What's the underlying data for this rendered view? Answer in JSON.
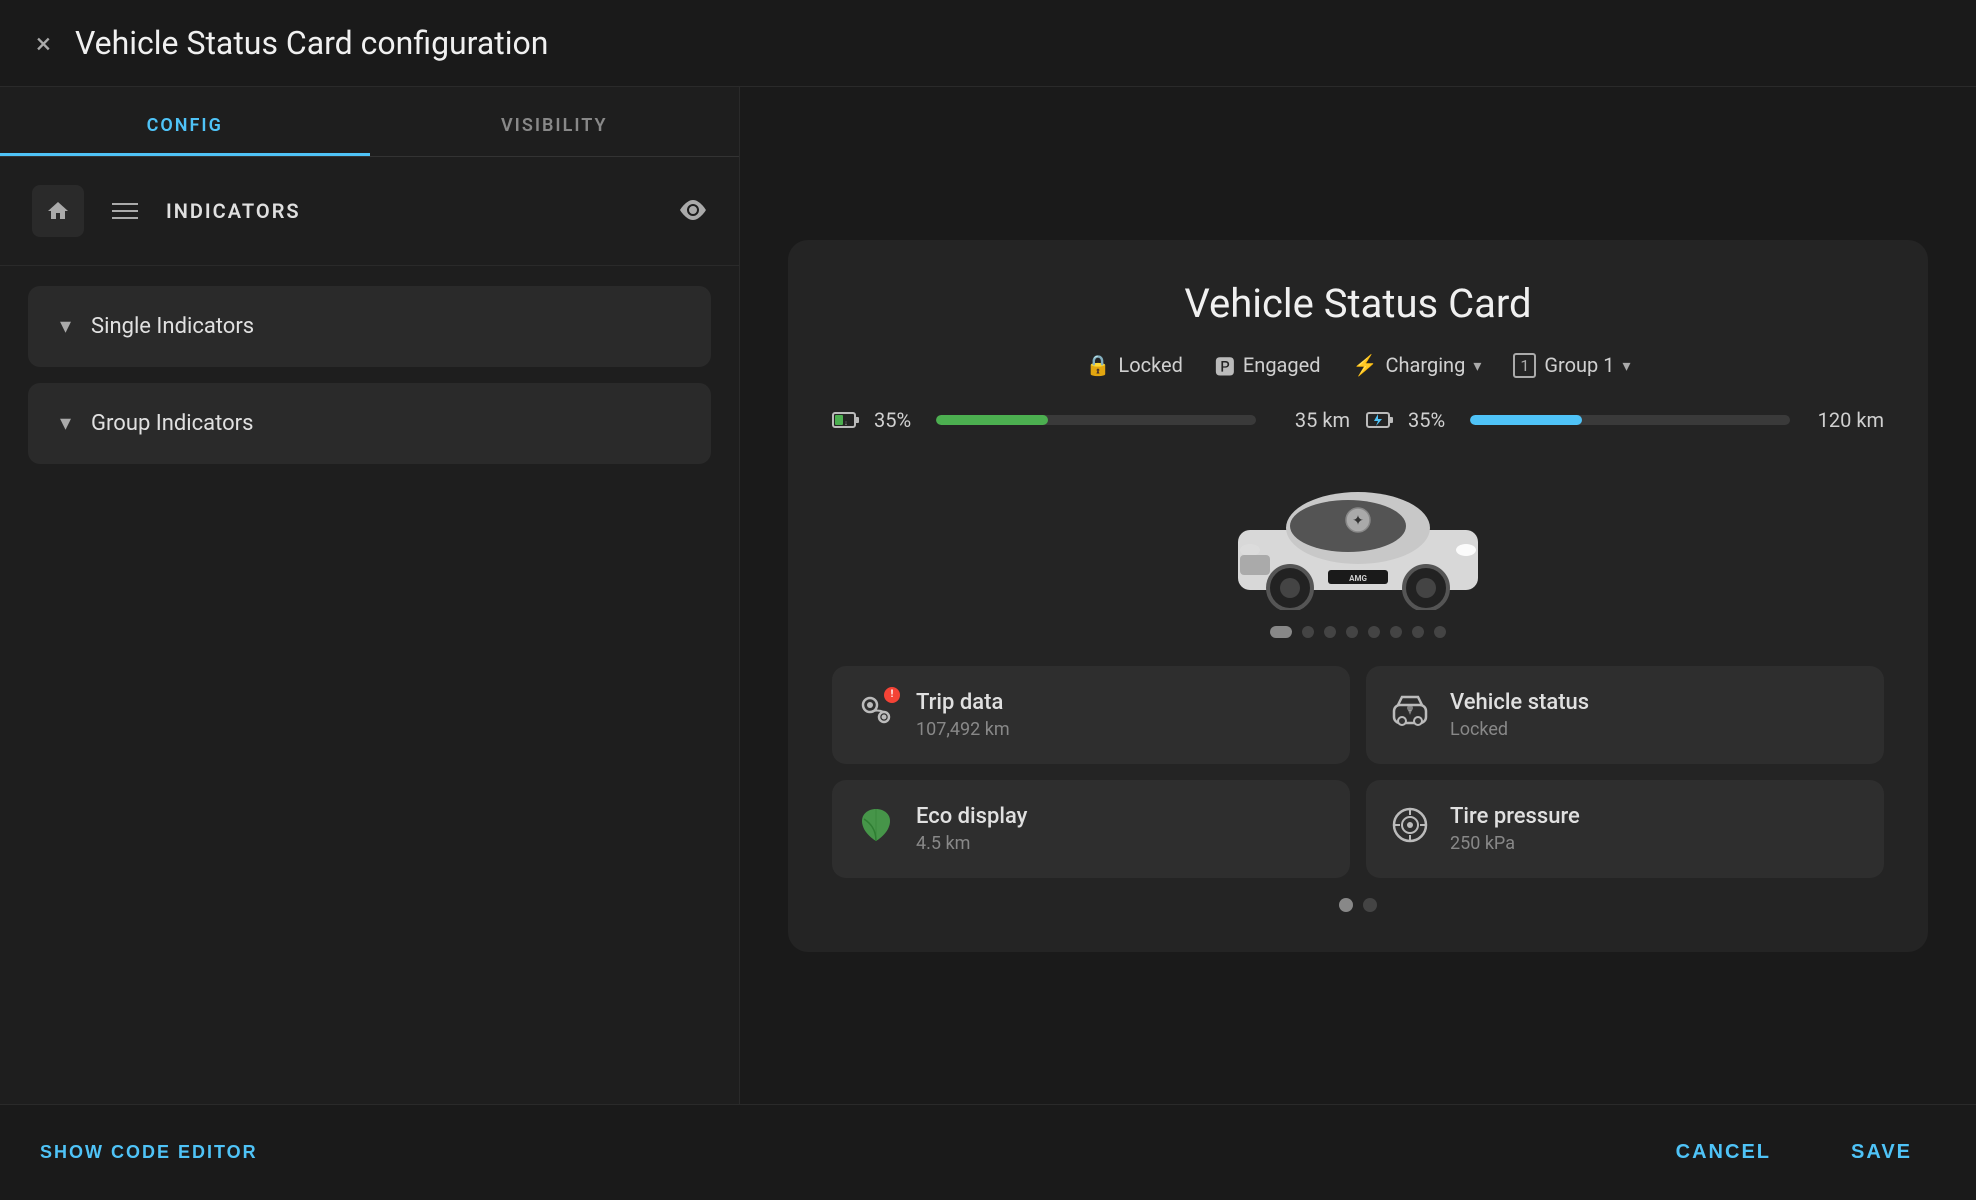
{
  "dialog": {
    "title": "Vehicle Status Card configuration",
    "close_label": "×"
  },
  "tabs": [
    {
      "label": "CONFIG",
      "active": true
    },
    {
      "label": "VISIBILITY",
      "active": false
    }
  ],
  "indicators_section": {
    "label": "INDICATORS"
  },
  "accordion": {
    "single_label": "Single Indicators",
    "group_label": "Group Indicators"
  },
  "preview_card": {
    "title": "Vehicle Status Card",
    "status_items": [
      {
        "icon": "🔒",
        "text": "Locked"
      },
      {
        "icon": "🅿",
        "text": "Engaged"
      },
      {
        "icon": "⚡",
        "text": "Charging",
        "dropdown": true
      },
      {
        "icon": "1",
        "text": "Group 1",
        "dropdown": true
      }
    ],
    "battery1": {
      "icon": "🔋",
      "percent": "35%",
      "km": "35 km",
      "color": "green"
    },
    "battery2": {
      "icon": "⚡",
      "percent": "35%",
      "km": "120 km",
      "color": "blue"
    },
    "dots": [
      true,
      false,
      false,
      false,
      false,
      false,
      false,
      false
    ],
    "info_cards": [
      {
        "id": "trip-data",
        "icon": "📍",
        "has_alert": true,
        "title": "Trip data",
        "subtitle": "107,492 km"
      },
      {
        "id": "vehicle-status",
        "icon": "🚗",
        "has_alert": false,
        "title": "Vehicle status",
        "subtitle": "Locked"
      },
      {
        "id": "eco-display",
        "icon": "🌿",
        "has_alert": false,
        "title": "Eco display",
        "subtitle": "4.5 km"
      },
      {
        "id": "tire-pressure",
        "icon": "⚙",
        "has_alert": false,
        "title": "Tire pressure",
        "subtitle": "250 kPa"
      }
    ],
    "page_dots": [
      true,
      false
    ]
  },
  "bottom_bar": {
    "show_code_label": "SHOW CODE EDITOR",
    "cancel_label": "CANCEL",
    "save_label": "SAVE"
  }
}
